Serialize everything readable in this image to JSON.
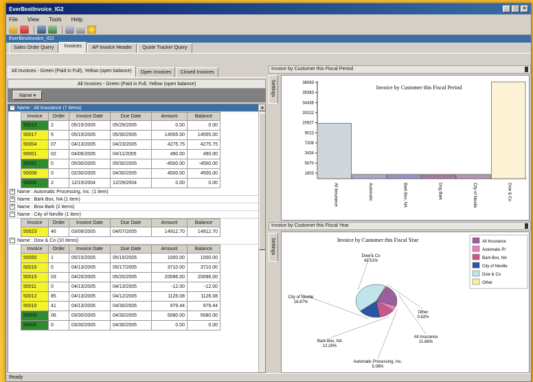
{
  "window": {
    "title": "EverBestInvoice_IG2",
    "subtitle": "EverBestInvoice_IG2"
  },
  "menu": [
    "File",
    "View",
    "Tools",
    "Help"
  ],
  "toolbar_icons": [
    "open-folder-icon",
    "edit-icon",
    "save-icon",
    "table-icon",
    "print-icon",
    "print-preview-icon",
    "help-icon"
  ],
  "tabs": [
    "Sales Order Query",
    "Invoices",
    "AP Invoice Header",
    "Quote Tracker Query"
  ],
  "subtabs": [
    "All Invoices - Green (Paid in Full), Yellow (open balance)",
    "Open Invoices",
    "Closed Invoices"
  ],
  "grid": {
    "caption": "All Invoices - Green (Paid in Full, Yellow (open balance)",
    "group_chip": "Name",
    "columns": [
      "Invoice",
      "Order",
      "Invoice Date",
      "Due Date",
      "Amount",
      "Balance"
    ],
    "groups": [
      {
        "label": "Name : All Insurance (7 items)",
        "expanded": true,
        "selected": true,
        "rows": [
          {
            "inv": "50013",
            "status": "green",
            "order": "2",
            "idate": "05/15/2005",
            "ddate": "05/29/2005",
            "amount": "0.00",
            "balance": "0.00"
          },
          {
            "inv": "50017",
            "status": "yellow",
            "order": "5",
            "idate": "05/15/2005",
            "ddate": "05/30/2005",
            "amount": "14555.00",
            "balance": "14555.00"
          },
          {
            "inv": "50004",
            "status": "yellow",
            "order": "07",
            "idate": "04/13/2005",
            "ddate": "04/23/2005",
            "amount": "4275.75",
            "balance": "4275.75"
          },
          {
            "inv": "50001",
            "status": "yellow",
            "order": "02",
            "idate": "04/06/2005",
            "ddate": "04/11/2005",
            "amount": "490.00",
            "balance": "490.00"
          },
          {
            "inv": "50031",
            "status": "green",
            "order": "0",
            "idate": "05/30/2005",
            "ddate": "05/30/2005",
            "amount": "-4500.00",
            "balance": "-4500.00"
          },
          {
            "inv": "50008",
            "status": "yellow",
            "order": "0",
            "idate": "02/30/2005",
            "ddate": "04/30/2005",
            "amount": "4500.00",
            "balance": "4500.00"
          },
          {
            "inv": "50000",
            "status": "green",
            "order": "2",
            "idate": "12/15/2004",
            "ddate": "12/29/2004",
            "amount": "0.00",
            "balance": "0.00"
          }
        ]
      },
      {
        "label": "Name : Automatic Processing, Inc. (1 item)",
        "expanded": false,
        "rows": []
      },
      {
        "label": "Name : Bark Box, NA (1 item)",
        "expanded": false,
        "rows": []
      },
      {
        "label": "Name : Bow Bark (2 items)",
        "expanded": false,
        "rows": []
      },
      {
        "label": "Name : City of Neville (1 item)",
        "expanded": true,
        "rows": [
          {
            "inv": "50023",
            "status": "yellow",
            "order": "46",
            "idate": "03/06/2005",
            "ddate": "04/07/2005",
            "amount": "14912.70",
            "balance": "14912.70"
          }
        ]
      },
      {
        "label": "Name : Dow & Co (10 items)",
        "expanded": true,
        "rows": [
          {
            "inv": "50050",
            "status": "yellow",
            "order": "1",
            "idate": "05/15/2005",
            "ddate": "05/15/2005",
            "amount": "1000.00",
            "balance": "1000.00"
          },
          {
            "inv": "50016",
            "status": "yellow",
            "order": "0",
            "idate": "04/13/2005",
            "ddate": "05/17/2005",
            "amount": "3710.00",
            "balance": "3710.00"
          },
          {
            "inv": "50015",
            "status": "yellow",
            "order": "03",
            "idate": "04/20/2005",
            "ddate": "05/20/2005",
            "amount": "20096.00",
            "balance": "20096.00"
          },
          {
            "inv": "50011",
            "status": "yellow",
            "order": "0",
            "idate": "04/13/2005",
            "ddate": "04/13/2005",
            "amount": "-12.00",
            "balance": "-12.00"
          },
          {
            "inv": "50012",
            "status": "yellow",
            "order": "85",
            "idate": "04/13/2005",
            "ddate": "04/12/2005",
            "amount": "1126.08",
            "balance": "1126.08"
          },
          {
            "inv": "50010",
            "status": "yellow",
            "order": "41",
            "idate": "04/13/2005",
            "ddate": "04/30/2005",
            "amount": "979.44",
            "balance": "979.44"
          },
          {
            "inv": "50006",
            "status": "green",
            "order": "06",
            "idate": "03/30/2005",
            "ddate": "04/30/2005",
            "amount": "5080.00",
            "balance": "5080.00"
          },
          {
            "inv": "50005",
            "status": "green",
            "order": "0",
            "idate": "03/30/2005",
            "ddate": "04/30/2005",
            "amount": "0.00",
            "balance": "0.00"
          }
        ]
      }
    ]
  },
  "bar_panel": {
    "header": "Invoice by Customer this Fiscal Period",
    "settings_label": "Settings",
    "chart_data": {
      "type": "bar",
      "title": "Invoice by Customer this Fiscal Period",
      "ytick_labels": [
        "38083",
        "35383",
        "34436",
        "30222",
        "20927",
        "9023",
        "7208",
        "3434",
        "5070",
        "1803"
      ],
      "categories": [
        "All Insurance",
        "Automatic",
        "Bark Box, NA",
        "Dog Bark",
        "City of Neville",
        "Dow & Co"
      ],
      "values": [
        21600,
        1650,
        1650,
        1650,
        1650,
        37800
      ],
      "colors": [
        "#cfd6dc",
        "#a7a9c8",
        "#9d8fc1",
        "#a77b9e",
        "#b794b4",
        "#fbf3d3"
      ],
      "ylim": [
        0,
        38083
      ]
    }
  },
  "pie_panel": {
    "header": "Invoice by Customer this Fiscal Year",
    "settings_label": "Settings",
    "chart_data": {
      "type": "pie",
      "title": "Invoice by Customer this Fiscal Year",
      "slices": [
        {
          "name": "All Insurance",
          "value": 21.66,
          "color": "#9b5e9e"
        },
        {
          "name": "Automatic Pr",
          "value": 5.08,
          "color": "#e87fb8"
        },
        {
          "name": "Bark Box, NA",
          "value": 12.26,
          "color": "#c85a8a"
        },
        {
          "name": "City of Neville",
          "value": 16.87,
          "color": "#2b56a8"
        },
        {
          "name": "Dow & Co",
          "value": 42.51,
          "color": "#bfe5ea"
        },
        {
          "name": "Other",
          "value": 0.62,
          "color": "#f6f0a8"
        }
      ],
      "data_labels": [
        {
          "text": "All Insurance",
          "pct": "21.66%"
        },
        {
          "text": "Automatic Processing, Inc.",
          "pct": "5.08%"
        },
        {
          "text": "Bark Box, NA",
          "pct": "12.26%"
        },
        {
          "text": "City of Neville",
          "pct": "16.87%"
        },
        {
          "text": "Dow & Co",
          "pct": "42.51%"
        },
        {
          "text": "Other",
          "pct": "0.62%"
        }
      ]
    }
  },
  "status": "Ready"
}
